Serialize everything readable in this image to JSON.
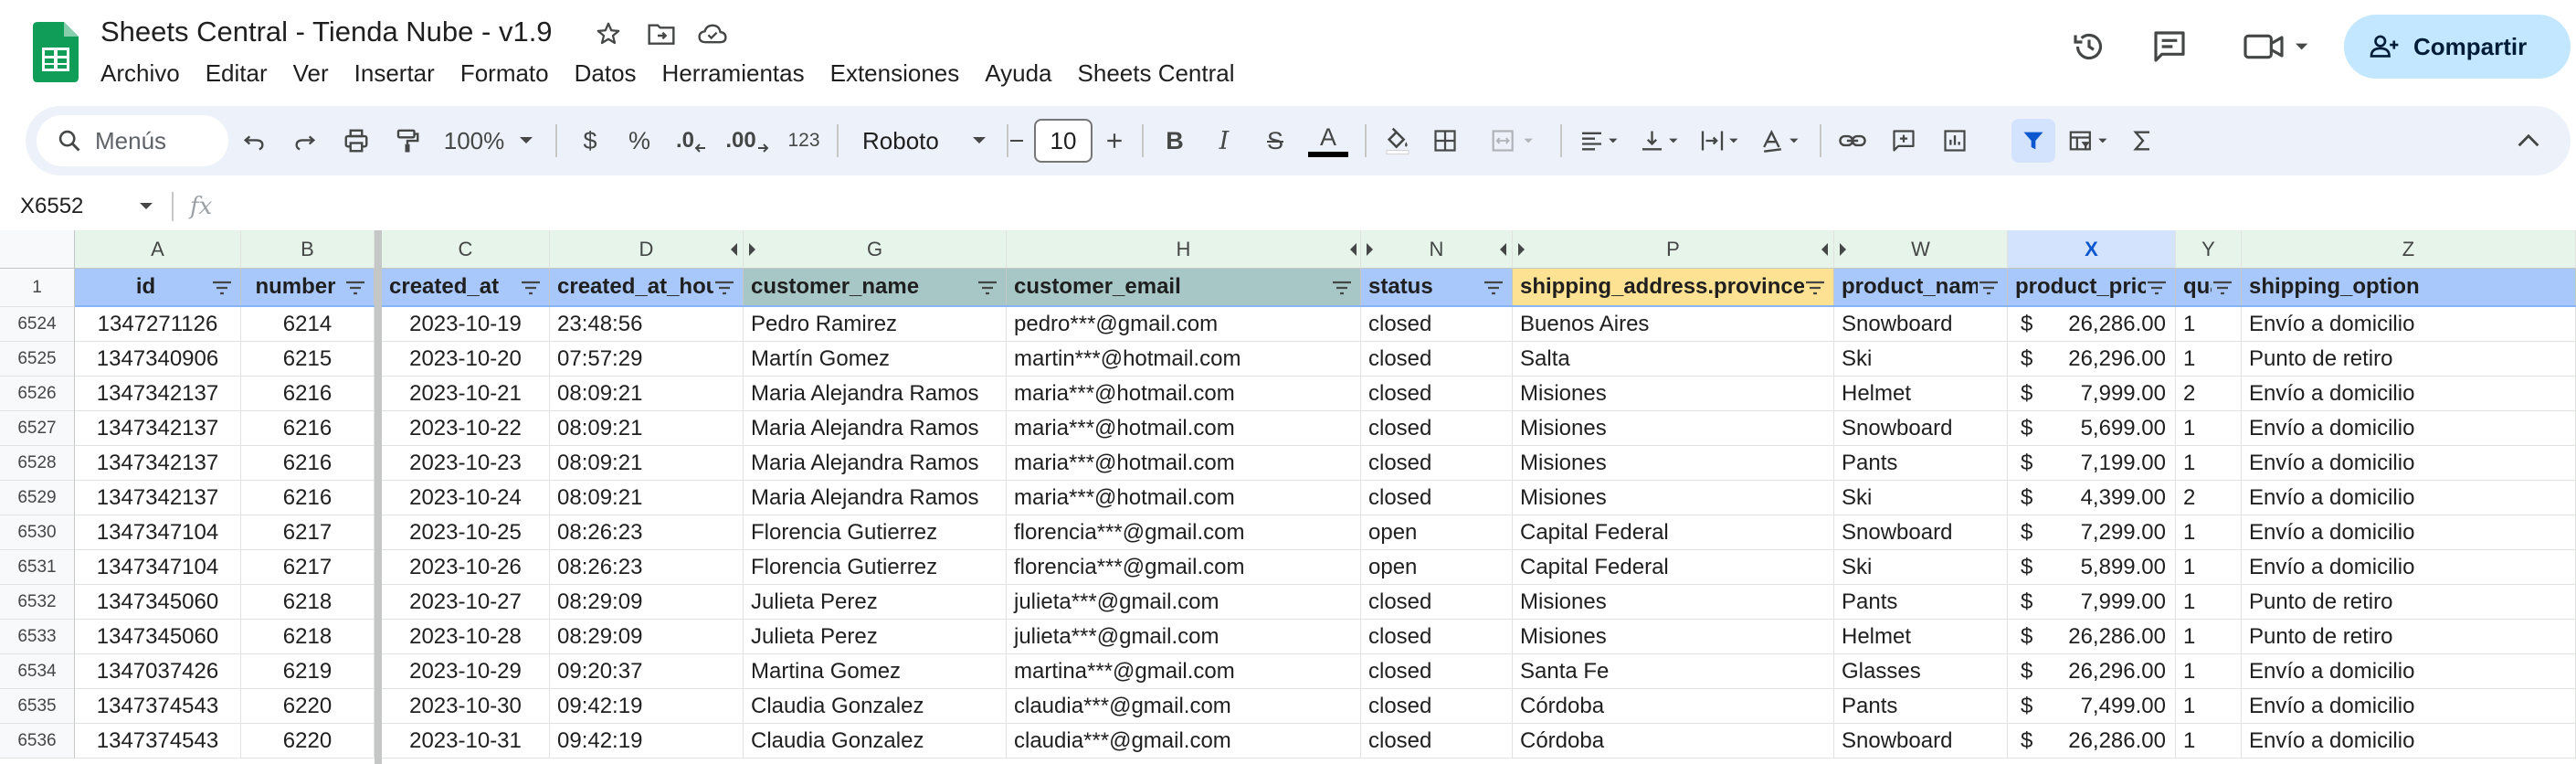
{
  "window": {
    "title": "Sheets Central - Tienda Nube - v1.9"
  },
  "menubar": {
    "items": [
      "Archivo",
      "Editar",
      "Ver",
      "Insertar",
      "Formato",
      "Datos",
      "Herramientas",
      "Extensiones",
      "Ayuda",
      "Sheets Central"
    ]
  },
  "share": {
    "label": "Compartir"
  },
  "toolbar": {
    "search_label": "Menús",
    "zoom": "100%",
    "currency": "$",
    "percent": "%",
    "decrease_decimals": ".0",
    "increase_decimals": ".00",
    "number_format": "123",
    "font_family": "Roboto",
    "font_size": "10",
    "bold": "B",
    "italic": "I",
    "strike": "S",
    "text_color_letter": "A"
  },
  "formula_bar": {
    "name_box": "X6552",
    "fx_label": "fx"
  },
  "colors": {
    "header_blue": "#a8c7fa",
    "header_teal": "#a7c7c7",
    "header_yellow": "#fde293",
    "accent": "#0b57d0",
    "selection_fill": "#d3e3fd"
  },
  "sheet": {
    "column_letters": [
      "A",
      "B",
      "C",
      "D",
      "G",
      "H",
      "N",
      "P",
      "W",
      "X",
      "Y",
      "Z"
    ],
    "header_row_number": "1",
    "headers": [
      "id",
      "number",
      "created_at",
      "created_at_hour",
      "customer_name",
      "customer_email",
      "status",
      "shipping_address.province",
      "product_name",
      "product_price",
      "quantity",
      "shipping_option"
    ],
    "rows": [
      {
        "row": "6524",
        "cells": [
          "1347271126",
          "6214",
          "2023-10-19",
          "23:48:56",
          "Pedro Ramirez",
          "pedro***@gmail.com",
          "closed",
          "Buenos Aires",
          "Snowboard",
          "26,286.00",
          "1",
          "Envío a domicilio"
        ]
      },
      {
        "row": "6525",
        "cells": [
          "1347340906",
          "6215",
          "2023-10-20",
          "07:57:29",
          "Martín Gomez",
          "martin***@hotmail.com",
          "closed",
          "Salta",
          "Ski",
          "26,296.00",
          "1",
          "Punto de retiro"
        ]
      },
      {
        "row": "6526",
        "cells": [
          "1347342137",
          "6216",
          "2023-10-21",
          "08:09:21",
          "Maria Alejandra Ramos",
          "maria***@hotmail.com",
          "closed",
          "Misiones",
          "Helmet",
          "7,999.00",
          "2",
          "Envío a domicilio"
        ]
      },
      {
        "row": "6527",
        "cells": [
          "1347342137",
          "6216",
          "2023-10-22",
          "08:09:21",
          "Maria Alejandra Ramos",
          "maria***@hotmail.com",
          "closed",
          "Misiones",
          "Snowboard",
          "5,699.00",
          "1",
          "Envío a domicilio"
        ]
      },
      {
        "row": "6528",
        "cells": [
          "1347342137",
          "6216",
          "2023-10-23",
          "08:09:21",
          "Maria Alejandra Ramos",
          "maria***@hotmail.com",
          "closed",
          "Misiones",
          "Pants",
          "7,199.00",
          "1",
          "Envío a domicilio"
        ]
      },
      {
        "row": "6529",
        "cells": [
          "1347342137",
          "6216",
          "2023-10-24",
          "08:09:21",
          "Maria Alejandra Ramos",
          "maria***@hotmail.com",
          "closed",
          "Misiones",
          "Ski",
          "4,399.00",
          "2",
          "Envío a domicilio"
        ]
      },
      {
        "row": "6530",
        "cells": [
          "1347347104",
          "6217",
          "2023-10-25",
          "08:26:23",
          "Florencia Gutierrez",
          "florencia***@gmail.com",
          "open",
          "Capital Federal",
          "Snowboard",
          "7,299.00",
          "1",
          "Envío a domicilio"
        ]
      },
      {
        "row": "6531",
        "cells": [
          "1347347104",
          "6217",
          "2023-10-26",
          "08:26:23",
          "Florencia Gutierrez",
          "florencia***@gmail.com",
          "open",
          "Capital Federal",
          "Ski",
          "5,899.00",
          "1",
          "Envío a domicilio"
        ]
      },
      {
        "row": "6532",
        "cells": [
          "1347345060",
          "6218",
          "2023-10-27",
          "08:29:09",
          "Julieta Perez",
          "julieta***@gmail.com",
          "closed",
          "Misiones",
          "Pants",
          "7,999.00",
          "1",
          "Punto de retiro"
        ]
      },
      {
        "row": "6533",
        "cells": [
          "1347345060",
          "6218",
          "2023-10-28",
          "08:29:09",
          "Julieta Perez",
          "julieta***@gmail.com",
          "closed",
          "Misiones",
          "Helmet",
          "26,286.00",
          "1",
          "Punto de retiro"
        ]
      },
      {
        "row": "6534",
        "cells": [
          "1347037426",
          "6219",
          "2023-10-29",
          "09:20:37",
          "Martina Gomez",
          "martina***@gmail.com",
          "closed",
          "Santa Fe",
          "Glasses",
          "26,296.00",
          "1",
          "Envío a domicilio"
        ]
      },
      {
        "row": "6535",
        "cells": [
          "1347374543",
          "6220",
          "2023-10-30",
          "09:42:19",
          "Claudia Gonzalez",
          "claudia***@gmail.com",
          "closed",
          "Córdoba",
          "Pants",
          "7,499.00",
          "1",
          "Envío a domicilio"
        ]
      },
      {
        "row": "6536",
        "cells": [
          "1347374543",
          "6220",
          "2023-10-31",
          "09:42:19",
          "Claudia Gonzalez",
          "claudia***@gmail.com",
          "closed",
          "Córdoba",
          "Snowboard",
          "26,286.00",
          "1",
          "Envío a domicilio"
        ]
      }
    ],
    "currency_symbol": "$"
  }
}
